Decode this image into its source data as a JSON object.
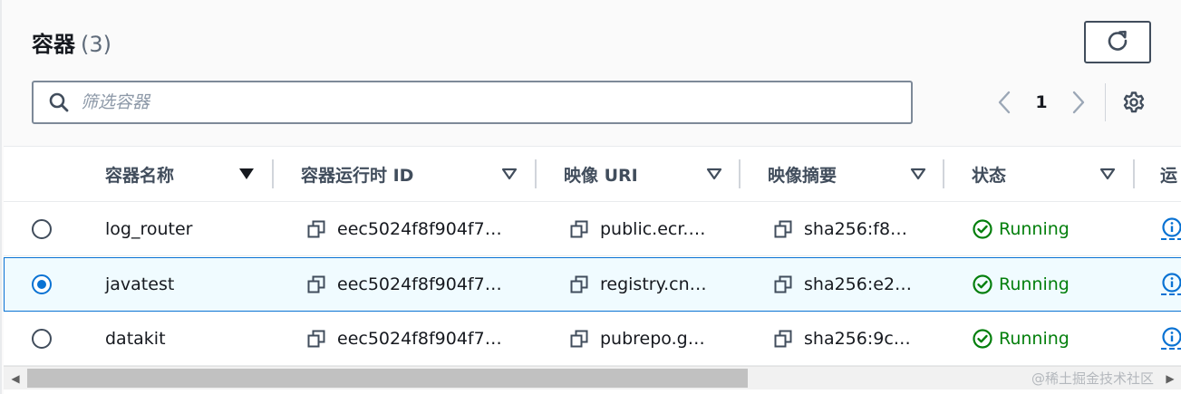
{
  "header": {
    "title": "容器",
    "count": "(3)"
  },
  "search": {
    "placeholder": "筛选容器",
    "value": ""
  },
  "pagination": {
    "current_page": "1"
  },
  "icons": {
    "refresh": "refresh-icon",
    "search": "search-icon",
    "prev": "chevron-left-icon",
    "next": "chevron-right-icon",
    "settings": "gear-icon",
    "copy": "copy-icon",
    "status": "check-circle-icon",
    "info": "info-icon"
  },
  "table": {
    "columns": [
      {
        "label": "容器名称"
      },
      {
        "label": "容器运行时 ID"
      },
      {
        "label": "映像 URI"
      },
      {
        "label": "映像摘要"
      },
      {
        "label": "状态"
      },
      {
        "label": "运"
      }
    ],
    "rows": [
      {
        "selected": false,
        "name": "log_router",
        "runtime_id": "eec5024f8f904f7…",
        "image_uri": "public.ecr.…",
        "digest": "sha256:f8…",
        "status": "Running"
      },
      {
        "selected": true,
        "name": "javatest",
        "runtime_id": "eec5024f8f904f7…",
        "image_uri": "registry.cn…",
        "digest": "sha256:e2…",
        "status": "Running"
      },
      {
        "selected": false,
        "name": "datakit",
        "runtime_id": "eec5024f8f904f7…",
        "image_uri": "pubrepo.g…",
        "digest": "sha256:9c…",
        "status": "Running"
      }
    ]
  },
  "watermark": "@稀土掘金技术社区",
  "colors": {
    "status_success": "#037f0c",
    "selection": "#0972d3",
    "border_strong": "#414d5c"
  }
}
